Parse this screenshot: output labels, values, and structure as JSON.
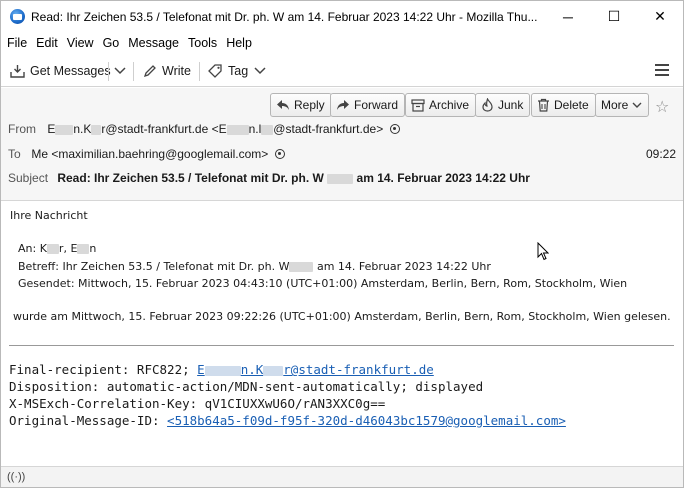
{
  "window": {
    "title": "Read: Ihr Zeichen 53.5 / Telefonat mit Dr. ph. W      am 14. Februar 2023 14:22 Uhr - Mozilla Thu...",
    "minimize": "─",
    "maximize": "☐",
    "close": "✕"
  },
  "menu": [
    "File",
    "Edit",
    "View",
    "Go",
    "Message",
    "Tools",
    "Help"
  ],
  "toolbar": {
    "get_messages": "Get Messages",
    "write": "Write",
    "tag": "Tag"
  },
  "actions": {
    "reply": "Reply",
    "forward": "Forward",
    "archive": "Archive",
    "junk": "Junk",
    "delete": "Delete",
    "more": "More"
  },
  "header": {
    "from_label": "From",
    "from_a": "E",
    "from_b": "n.K",
    "from_c": "r@stadt-frankfurt.de <E",
    "from_d": "n.l",
    "from_e": "@stadt-frankfurt.de>",
    "to_label": "To",
    "to_value": "Me <maximilian.baehring@googlemail.com>",
    "time": "09:22",
    "subject_label": "Subject",
    "subject_a": "Read: Ihr Zeichen 53.5 / Telefonat mit Dr. ph. W",
    "subject_b": "am 14. Februar 2023 14:22 Uhr"
  },
  "body": {
    "intro": "Ihre Nachricht",
    "an_a": "An: K",
    "an_b": "r, E",
    "an_c": "n",
    "betreff_a": "Betreff: Ihr Zeichen 53.5 / Telefonat mit Dr. ph. W",
    "betreff_b": "am 14. Februar 2023 14:22 Uhr",
    "gesendet": "Gesendet: Mittwoch, 15. Februar 2023 04:43:10 (UTC+01:00) Amsterdam, Berlin, Bern, Rom, Stockholm, Wien",
    "gelesen": "wurde am Mittwoch, 15. Februar 2023 09:22:26 (UTC+01:00) Amsterdam, Berlin, Bern, Rom, Stockholm, Wien gelesen.",
    "final_label": "Final-recipient: RFC822; ",
    "final_a": "E",
    "final_b": "n.K",
    "final_c": "r@stadt-frankfurt.de",
    "disposition": "Disposition: automatic-action/MDN-sent-automatically; displayed",
    "correlation": "X-MSExch-Correlation-Key: qV1CIUXXwU6O/rAN3XXC0g==",
    "orig_label": "Original-Message-ID: ",
    "orig_value": "<518b64a5-f09d-f95f-320d-d46043bc1579@googlemail.com>"
  },
  "status": {
    "icon": "((·))"
  }
}
